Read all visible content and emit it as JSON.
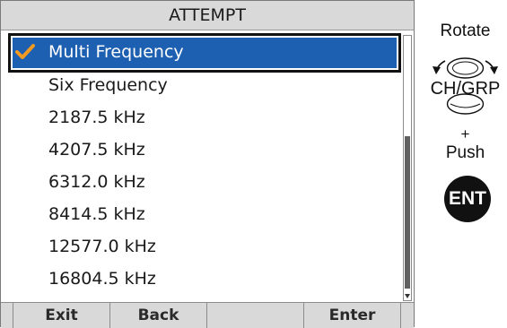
{
  "screen": {
    "title": "ATTEMPT",
    "items": [
      {
        "label": "Multi Frequency",
        "checked": true
      },
      {
        "label": "Six Frequency"
      },
      {
        "label": "2187.5 kHz"
      },
      {
        "label": "4207.5 kHz"
      },
      {
        "label": "6312.0 kHz"
      },
      {
        "label": "8414.5 kHz"
      },
      {
        "label": "12577.0 kHz"
      },
      {
        "label": "16804.5 kHz"
      }
    ],
    "softkeys": [
      "Exit",
      "Back",
      "",
      "Enter"
    ]
  },
  "panel": {
    "rotate": "Rotate",
    "knob_label": "CH/GRP",
    "plus": "+",
    "push": "Push",
    "ent": "ENT"
  },
  "colors": {
    "selection": "#1d5fb0",
    "check": "#f29a21",
    "softkey_bar": "#d9d9d9"
  },
  "icons": [
    "check-icon",
    "rotary-knob-icon",
    "scroll-down-arrow-icon"
  ]
}
